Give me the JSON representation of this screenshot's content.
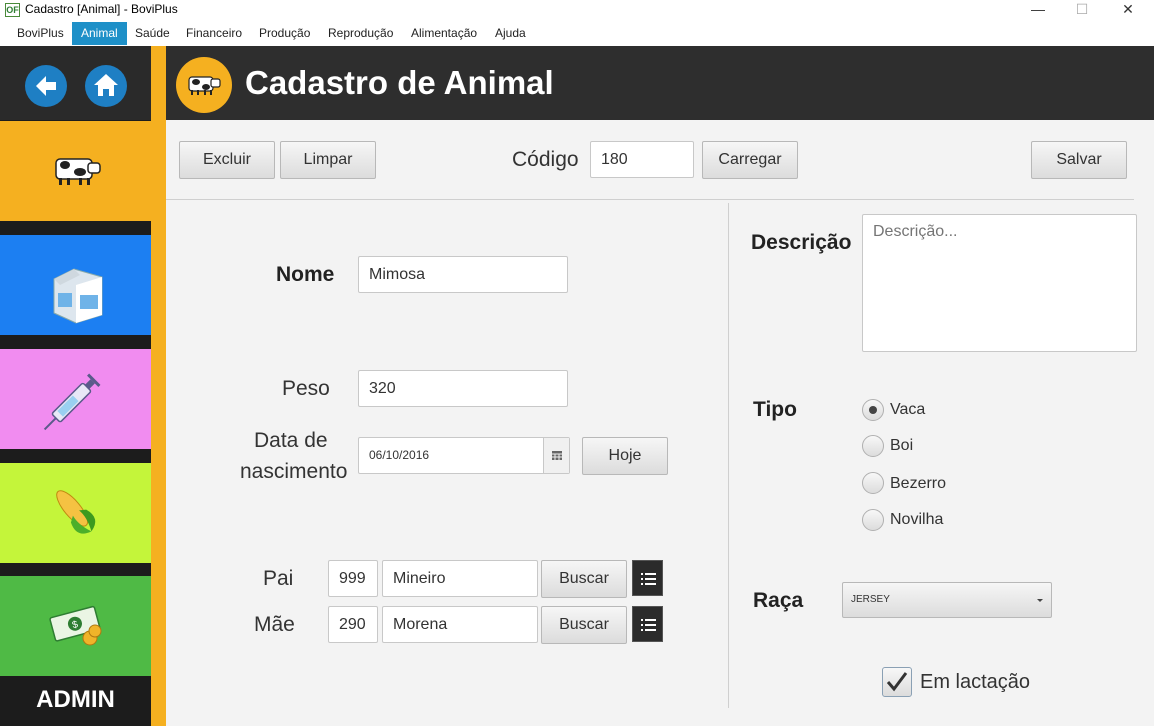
{
  "window": {
    "title": "Cadastro [Animal] - BoviPlus",
    "app_icon": "OF",
    "minimize_glyph": "—",
    "maximize_glyph": "☐",
    "close_glyph": "✕"
  },
  "menu": [
    "BoviPlus",
    "Animal",
    "Saúde",
    "Financeiro",
    "Produção",
    "Reprodução",
    "Alimentação",
    "Ajuda"
  ],
  "menu_active": "Animal",
  "sidebar": {
    "tiles": [
      {
        "name": "animal",
        "icon": "cow-icon",
        "color": "#f5b020"
      },
      {
        "name": "producao",
        "icon": "milk-carton-icon",
        "color": "#1c7ff2"
      },
      {
        "name": "saude",
        "icon": "syringe-icon",
        "color": "#f18cf0"
      },
      {
        "name": "alimentacao",
        "icon": "corn-icon",
        "color": "#c4f53a"
      },
      {
        "name": "financeiro",
        "icon": "money-icon",
        "color": "#4fba45"
      }
    ],
    "admin_label": "ADMIN"
  },
  "header": {
    "title": "Cadastro de Animal"
  },
  "toolbar": {
    "excluir": "Excluir",
    "limpar": "Limpar",
    "codigo_label": "Código",
    "codigo_value": "180",
    "carregar": "Carregar",
    "salvar": "Salvar"
  },
  "form": {
    "nome_label": "Nome",
    "nome_value": "Mimosa",
    "peso_label": "Peso",
    "peso_value": "320",
    "data_label_1": "Data de",
    "data_label_2": "nascimento",
    "data_value": "06/10/2016",
    "hoje": "Hoje",
    "pai_label": "Pai",
    "pai_codigo": "999",
    "pai_nome": "Mineiro",
    "mae_label": "Mãe",
    "mae_codigo": "290",
    "mae_nome": "Morena",
    "buscar": "Buscar"
  },
  "right": {
    "descricao_label": "Descrição",
    "descricao_placeholder": "Descrição...",
    "tipo_label": "Tipo",
    "tipo_options": [
      "Vaca",
      "Boi",
      "Bezerro",
      "Novilha"
    ],
    "tipo_selected": "Vaca",
    "raca_label": "Raça",
    "raca_value": "JERSEY",
    "lactacao_label": "Em lactação",
    "lactacao_checked": true
  }
}
